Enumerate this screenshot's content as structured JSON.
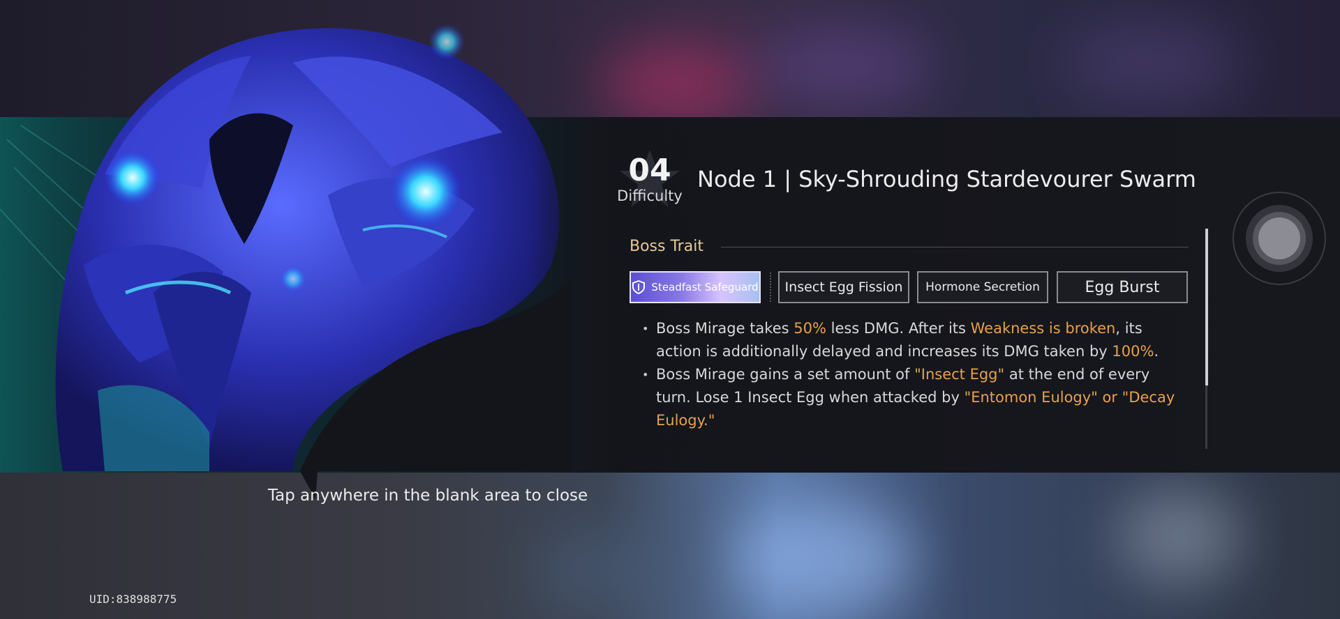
{
  "difficulty": {
    "number": "04",
    "label": "Difficulty"
  },
  "node": {
    "title": "Node 1 | Sky-Shrouding Stardevourer Swarm"
  },
  "boss_trait": {
    "heading": "Boss Trait",
    "tabs": [
      {
        "label": "Steadfast Safeguard",
        "active": true
      },
      {
        "label": "Insect Egg Fission",
        "active": false
      },
      {
        "label": "Hormone Secretion",
        "active": false
      },
      {
        "label": "Egg Burst",
        "active": false
      }
    ],
    "desc": {
      "p1": {
        "t1": "Boss Mirage takes ",
        "h1": "50%",
        "t2": " less DMG. After its ",
        "h2": "Weakness is broken",
        "t3": ", its action is additionally delayed and increases its DMG taken by ",
        "h3": "100%",
        "t4": "."
      },
      "p2": {
        "t1": "Boss Mirage gains a set amount of ",
        "h1": "\"Insect Egg\"",
        "t2": " at the end of every turn. Lose 1 Insect Egg when attacked by ",
        "h2": "\"Entomon Eulogy\" or \"Decay Eulogy.\""
      }
    }
  },
  "close_hint": "Tap anywhere in the blank area to close",
  "uid": "UID:838988775",
  "colors": {
    "highlight": "#e8a14c",
    "trait_heading": "#e8c995",
    "active_tab": "#8a7ae6"
  },
  "icons": {
    "shield": "shield-icon",
    "dial": "joystick-dial-icon"
  }
}
